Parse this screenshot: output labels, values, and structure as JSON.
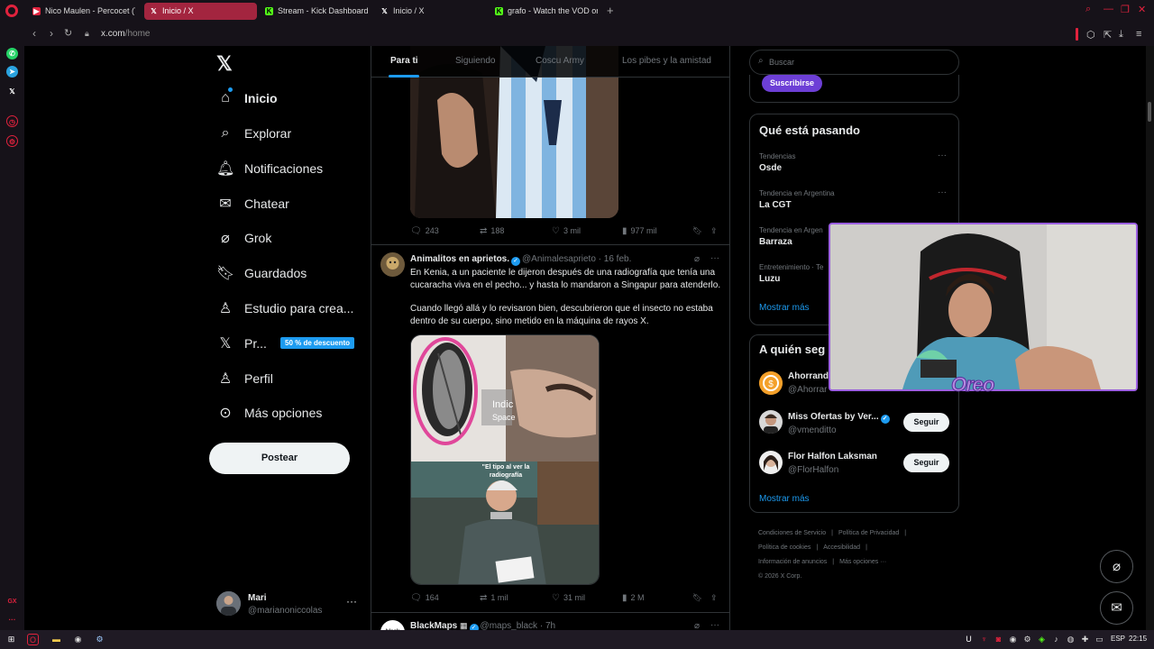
{
  "browser": {
    "tabs": [
      {
        "title": "Nico Maulen - Percocet (T",
        "favicon": "youtube",
        "active": false
      },
      {
        "title": "Inicio / X",
        "favicon": "x",
        "active": true
      },
      {
        "title": "Stream - Kick Dashboard",
        "favicon": "kick",
        "active": false
      },
      {
        "title": "Inicio / X",
        "favicon": "x",
        "active": false
      },
      {
        "title": "grafo - Watch the VOD on",
        "favicon": "kick",
        "active": false
      }
    ],
    "new_tab": "+",
    "url_host": "x.com",
    "url_path": "/home",
    "accent": "#e0223d"
  },
  "nav": {
    "items": [
      {
        "label": "Inicio",
        "icon": "home-icon"
      },
      {
        "label": "Explorar",
        "icon": "search-icon"
      },
      {
        "label": "Notificaciones",
        "icon": "bell-icon"
      },
      {
        "label": "Chatear",
        "icon": "mail-icon"
      },
      {
        "label": "Grok",
        "icon": "grok-icon"
      },
      {
        "label": "Guardados",
        "icon": "bookmark-icon"
      },
      {
        "label": "Estudio para crea...",
        "icon": "studio-icon"
      },
      {
        "label": "Pr...",
        "icon": "x-premium-icon"
      },
      {
        "label": "Perfil",
        "icon": "person-icon"
      },
      {
        "label": "Más opciones",
        "icon": "more-circle-icon"
      }
    ],
    "premium_badge": "50 % de descuento",
    "post_button": "Postear",
    "account": {
      "name": "Mari",
      "handle": "@marianoniccolas"
    }
  },
  "feed": {
    "tabs": [
      "Para ti",
      "Siguiendo",
      "Coscu Army",
      "Los pibes y la amistad"
    ],
    "post1_stats": {
      "replies": "243",
      "reposts": "188",
      "likes": "3 mil",
      "views": "977 mil"
    },
    "post2": {
      "name": "Animalitos en aprietos.",
      "handle": "@Animalesaprieto",
      "time": "· 16 feb.",
      "text1": "En Kenia, a un paciente le dijeron después de una radiografía que tenía una cucaracha viva en el pecho... y hasta lo mandaron a Singapur para atenderlo.",
      "text2": "Cuando llegó allá y lo revisaron bien, descubrieron que el insecto no estaba dentro de su cuerpo, sino metido en la máquina de rayos X.",
      "media_overlay_1": "Indic Space",
      "media_caption": "\"El tipo al ver la radiografía",
      "stats": {
        "replies": "164",
        "reposts": "1 mil",
        "likes": "31 mil",
        "views": "2 M"
      }
    },
    "post3": {
      "name": "BlackMaps",
      "handle": "@maps_black",
      "time": "· 7h",
      "avatar_text": "black"
    }
  },
  "right": {
    "search_placeholder": "Buscar",
    "subscribe": "Suscribirse",
    "trends_title": "Qué está pasando",
    "trends": [
      {
        "category": "Tendencias",
        "name": "Osde"
      },
      {
        "category": "Tendencia en Argentina",
        "name": "La CGT"
      },
      {
        "category": "Tendencia en Argen",
        "name": "Barraza"
      },
      {
        "category": "Entretenimiento · Te",
        "name": "Luzu"
      }
    ],
    "trends_more": "Mostrar más",
    "follow_title": "A quién seg",
    "follow": [
      {
        "name": "Ahorrand",
        "handle": "@Ahorrar",
        "verified": false,
        "button": ""
      },
      {
        "name": "Miss Ofertas by Ver...",
        "handle": "@vmenditto",
        "verified": true,
        "button": "Seguir"
      },
      {
        "name": "Flor Halfon Laksman",
        "handle": "@FlorHalfon",
        "verified": false,
        "button": "Seguir"
      }
    ],
    "follow_more": "Mostrar más",
    "footer": [
      "Condiciones de Servicio",
      "Política de Privacidad",
      "Política de cookies",
      "Accesibilidad",
      "Información de anuncios",
      "Más opciones ···",
      "© 2026 X Corp."
    ]
  },
  "overlay": {
    "watermark": "Oreo"
  },
  "taskbar": {
    "lang": "ESP",
    "time": "22:15"
  }
}
